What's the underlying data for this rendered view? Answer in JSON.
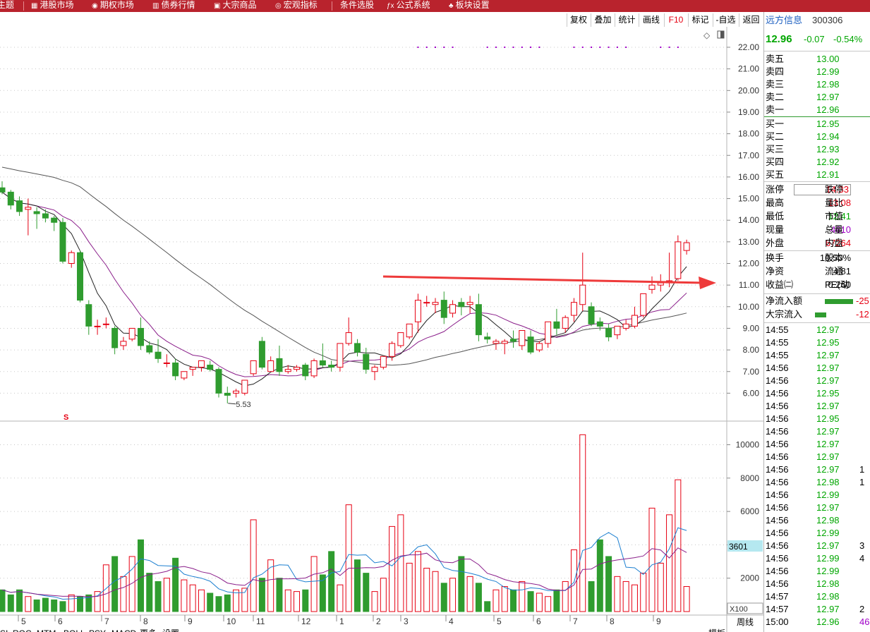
{
  "topbar": {
    "items": [
      {
        "label": "主题",
        "icon": ""
      },
      {
        "label": "港股市场",
        "icon": "grid-icon"
      },
      {
        "label": "期权市场",
        "icon": "coin-icon"
      },
      {
        "label": "债券行情",
        "icon": "bank-icon"
      },
      {
        "label": "大宗商品",
        "icon": "box-icon"
      },
      {
        "label": "宏观指标",
        "icon": "globe-icon"
      },
      {
        "label": "条件选股",
        "icon": ""
      },
      {
        "label": "公式系统",
        "icon": "fx-icon"
      },
      {
        "label": "板块设置",
        "icon": "blocks-icon"
      }
    ]
  },
  "toolbar": {
    "buttons": [
      "复权",
      "叠加",
      "统计",
      "画线",
      "F10",
      "标记",
      "-自选",
      "返回"
    ]
  },
  "chart": {
    "price_axis": [
      "22.00",
      "21.00",
      "20.00",
      "19.00",
      "18.00",
      "17.00",
      "16.00",
      "15.00",
      "14.00",
      "13.00",
      "12.00",
      "11.00",
      "10.00",
      "9.00",
      "8.00",
      "7.00",
      "6.00"
    ],
    "low_label": "5.53",
    "marker_s": "S",
    "volume_axis": [
      "10000",
      "8000",
      "6000",
      "4000",
      "2000"
    ],
    "volume_current": "3601",
    "volume_unit": "X100",
    "period_button": "周线",
    "month_labels": [
      "5",
      "6",
      "7",
      "8",
      "9",
      "10",
      "11",
      "12",
      "1",
      "2",
      "3",
      "4",
      "5",
      "6",
      "7",
      "8",
      "9"
    ],
    "bottom_tabs": [
      "SI",
      "ROC",
      "MTM",
      "BOLL",
      "PSY",
      "MACD",
      "更多",
      "设置"
    ],
    "bottom_right": "模板"
  },
  "chart_data": {
    "type": "candlestick",
    "candles": [
      [
        15.5,
        15.8,
        15.3,
        15.2
      ],
      [
        15.3,
        15.4,
        14.7,
        14.5
      ],
      [
        14.9,
        15.1,
        14.4,
        14.2
      ],
      [
        14.5,
        15.0,
        14.6,
        13.3
      ],
      [
        14.4,
        14.6,
        14.3,
        13.6
      ],
      [
        14.3,
        14.5,
        14.1,
        13.9
      ],
      [
        14.1,
        14.2,
        13.9,
        13.5
      ],
      [
        13.9,
        14.1,
        12.1,
        12.0
      ],
      [
        12.0,
        12.6,
        12.5,
        11.8
      ],
      [
        12.5,
        12.6,
        10.3,
        10.2
      ],
      [
        10.1,
        10.3,
        9.1,
        8.7
      ],
      [
        9.1,
        9.4,
        9.1,
        8.7
      ],
      [
        9.2,
        9.5,
        9.2,
        9.0
      ],
      [
        9.0,
        9.1,
        8.1,
        7.8
      ],
      [
        8.2,
        8.6,
        8.4,
        8.0
      ],
      [
        8.5,
        8.8,
        9.0,
        8.4
      ],
      [
        9.0,
        9.5,
        8.2,
        8.0
      ],
      [
        8.2,
        8.4,
        7.9,
        7.8
      ],
      [
        7.9,
        8.5,
        7.6,
        7.4
      ],
      [
        7.4,
        7.8,
        7.4,
        7.2
      ],
      [
        7.4,
        7.6,
        6.8,
        6.6
      ],
      [
        6.7,
        6.9,
        7.0,
        6.6
      ],
      [
        7.1,
        7.2,
        7.2,
        6.8
      ],
      [
        7.2,
        7.5,
        7.5,
        7.0
      ],
      [
        7.3,
        7.5,
        7.1,
        7.0
      ],
      [
        7.1,
        7.2,
        6.0,
        5.8
      ],
      [
        6.0,
        6.3,
        5.9,
        5.53
      ],
      [
        6.0,
        6.2,
        6.1,
        5.8
      ],
      [
        6.0,
        6.6,
        6.6,
        5.9
      ],
      [
        6.9,
        7.4,
        7.5,
        6.8
      ],
      [
        8.4,
        8.6,
        7.2,
        7.1
      ],
      [
        7.0,
        7.7,
        7.5,
        7.0
      ],
      [
        7.6,
        8.2,
        7.0,
        6.8
      ],
      [
        7.0,
        7.3,
        7.1,
        6.9
      ],
      [
        7.1,
        7.3,
        7.2,
        7.0
      ],
      [
        7.3,
        7.4,
        6.8,
        6.6
      ],
      [
        6.8,
        7.6,
        7.5,
        6.7
      ],
      [
        7.5,
        8.3,
        7.3,
        7.2
      ],
      [
        7.3,
        7.5,
        7.2,
        7.0
      ],
      [
        7.2,
        8.0,
        8.3,
        7.0
      ],
      [
        8.3,
        9.5,
        8.8,
        8.2
      ],
      [
        8.3,
        8.5,
        7.9,
        7.7
      ],
      [
        7.8,
        8.1,
        7.1,
        6.9
      ],
      [
        7.0,
        7.3,
        7.2,
        6.6
      ],
      [
        7.2,
        7.6,
        7.7,
        7.1
      ],
      [
        7.7,
        8.4,
        8.3,
        7.5
      ],
      [
        8.2,
        8.8,
        8.8,
        8.1
      ],
      [
        8.6,
        9.1,
        9.2,
        8.5
      ],
      [
        9.3,
        10.6,
        10.3,
        8.8
      ],
      [
        10.2,
        10.5,
        10.2,
        10.0
      ],
      [
        10.1,
        10.4,
        10.2,
        9.7
      ],
      [
        10.3,
        10.7,
        9.5,
        9.2
      ],
      [
        9.7,
        10.3,
        10.1,
        9.5
      ],
      [
        10.2,
        10.4,
        10.0,
        9.6
      ],
      [
        10.1,
        10.5,
        10.2,
        9.7
      ],
      [
        10.1,
        10.6,
        8.7,
        8.4
      ],
      [
        8.6,
        8.8,
        8.5,
        8.3
      ],
      [
        8.3,
        8.5,
        8.4,
        8.0
      ],
      [
        8.3,
        8.5,
        8.4,
        7.8
      ],
      [
        8.5,
        8.9,
        8.4,
        8.1
      ],
      [
        8.2,
        8.7,
        8.9,
        8.0
      ],
      [
        8.6,
        8.9,
        7.9,
        7.8
      ],
      [
        8.0,
        8.4,
        8.3,
        7.9
      ],
      [
        8.3,
        9.0,
        9.3,
        8.1
      ],
      [
        9.3,
        9.9,
        9.0,
        8.7
      ],
      [
        9.0,
        9.6,
        9.5,
        8.8
      ],
      [
        9.6,
        10.4,
        10.2,
        9.3
      ],
      [
        10.1,
        12.5,
        11.0,
        9.8
      ],
      [
        10.0,
        10.2,
        9.2,
        9.1
      ],
      [
        9.3,
        9.5,
        9.1,
        8.9
      ],
      [
        9.0,
        9.2,
        8.6,
        8.4
      ],
      [
        8.7,
        9.0,
        9.1,
        8.5
      ],
      [
        9.0,
        9.4,
        9.2,
        8.9
      ],
      [
        9.1,
        10.0,
        9.6,
        9.0
      ],
      [
        9.6,
        10.6,
        10.6,
        9.5
      ],
      [
        10.8,
        11.4,
        11.0,
        10.6
      ],
      [
        11.0,
        11.5,
        11.1,
        10.7
      ],
      [
        11.1,
        12.5,
        11.2,
        10.9
      ],
      [
        11.3,
        13.3,
        13.0,
        11.2
      ],
      [
        12.6,
        13.1,
        12.96,
        12.41
      ]
    ],
    "volume": [
      1300,
      1000,
      1300,
      900,
      700,
      800,
      700,
      600,
      1000,
      900,
      1000,
      1200,
      2800,
      3300,
      2100,
      3300,
      4300,
      2300,
      1800,
      2000,
      3200,
      1900,
      1600,
      1300,
      1100,
      900,
      1000,
      1300,
      1400,
      5500,
      2000,
      3100,
      2000,
      1300,
      1200,
      1300,
      3300,
      2200,
      3600,
      1600,
      6400,
      3100,
      2300,
      1200,
      2000,
      5100,
      5800,
      2900,
      3600,
      2600,
      2400,
      1700,
      2000,
      3300,
      2100,
      1700,
      600,
      1300,
      1500,
      1300,
      1800,
      1200,
      1100,
      900,
      1300,
      1800,
      3700,
      10600,
      1800,
      4300,
      3300,
      2100,
      1800,
      1600,
      2300,
      6200,
      2900,
      5800,
      7900,
      1500
    ]
  },
  "panel": {
    "stock_name": "远方信息",
    "stock_code": "300306",
    "price": "12.96",
    "change": "-0.07",
    "change_pct": "-0.54%",
    "sell": [
      {
        "label": "卖五",
        "price": "13.00"
      },
      {
        "label": "卖四",
        "price": "12.99"
      },
      {
        "label": "卖三",
        "price": "12.98"
      },
      {
        "label": "卖二",
        "price": "12.97"
      },
      {
        "label": "卖一",
        "price": "12.96"
      }
    ],
    "buy": [
      {
        "label": "买一",
        "price": "12.95"
      },
      {
        "label": "买二",
        "price": "12.94"
      },
      {
        "label": "买三",
        "price": "12.93"
      },
      {
        "label": "买四",
        "price": "12.92"
      },
      {
        "label": "买五",
        "price": "12.91"
      }
    ],
    "stats1": [
      {
        "label": "涨停",
        "value": "14.33",
        "label2": "跌停",
        "color": "red"
      },
      {
        "label": "最高",
        "value": "13.08",
        "label2": "量比",
        "color": "red"
      },
      {
        "label": "最低",
        "value": "12.41",
        "label2": "市值",
        "color": "green"
      },
      {
        "label": "现量",
        "value": "4610",
        "label2": "总量",
        "color": "purple"
      },
      {
        "label": "外盘",
        "value": "67264",
        "label2": "内盘",
        "color": "red"
      }
    ],
    "stats2": [
      {
        "label": "换手",
        "value": "10.50%",
        "label2": "股本"
      },
      {
        "label": "净资",
        "value": "4.81",
        "label2": "流通"
      },
      {
        "label": "收益㈡",
        "value": "0.260",
        "label2": "PE(动"
      }
    ],
    "flows": [
      {
        "label": "净流入额",
        "value": "-25"
      },
      {
        "label": "大宗流入",
        "value": "-12"
      }
    ],
    "ticks": [
      {
        "time": "14:55",
        "price": "12.97",
        "vol": ""
      },
      {
        "time": "14:55",
        "price": "12.95",
        "vol": ""
      },
      {
        "time": "14:55",
        "price": "12.97",
        "vol": ""
      },
      {
        "time": "14:56",
        "price": "12.97",
        "vol": ""
      },
      {
        "time": "14:56",
        "price": "12.97",
        "vol": ""
      },
      {
        "time": "14:56",
        "price": "12.95",
        "vol": ""
      },
      {
        "time": "14:56",
        "price": "12.97",
        "vol": ""
      },
      {
        "time": "14:56",
        "price": "12.95",
        "vol": ""
      },
      {
        "time": "14:56",
        "price": "12.97",
        "vol": ""
      },
      {
        "time": "14:56",
        "price": "12.97",
        "vol": ""
      },
      {
        "time": "14:56",
        "price": "12.97",
        "vol": ""
      },
      {
        "time": "14:56",
        "price": "12.97",
        "vol": "1"
      },
      {
        "time": "14:56",
        "price": "12.98",
        "vol": "1"
      },
      {
        "time": "14:56",
        "price": "12.99",
        "vol": ""
      },
      {
        "time": "14:56",
        "price": "12.97",
        "vol": ""
      },
      {
        "time": "14:56",
        "price": "12.98",
        "vol": ""
      },
      {
        "time": "14:56",
        "price": "12.99",
        "vol": ""
      },
      {
        "time": "14:56",
        "price": "12.97",
        "vol": "3"
      },
      {
        "time": "14:56",
        "price": "12.99",
        "vol": "4"
      },
      {
        "time": "14:56",
        "price": "12.99",
        "vol": ""
      },
      {
        "time": "14:56",
        "price": "12.98",
        "vol": ""
      },
      {
        "time": "14:57",
        "price": "12.98",
        "vol": ""
      },
      {
        "time": "14:57",
        "price": "12.97",
        "vol": "2"
      },
      {
        "time": "15:00",
        "price": "12.96",
        "vol": "46"
      }
    ]
  }
}
